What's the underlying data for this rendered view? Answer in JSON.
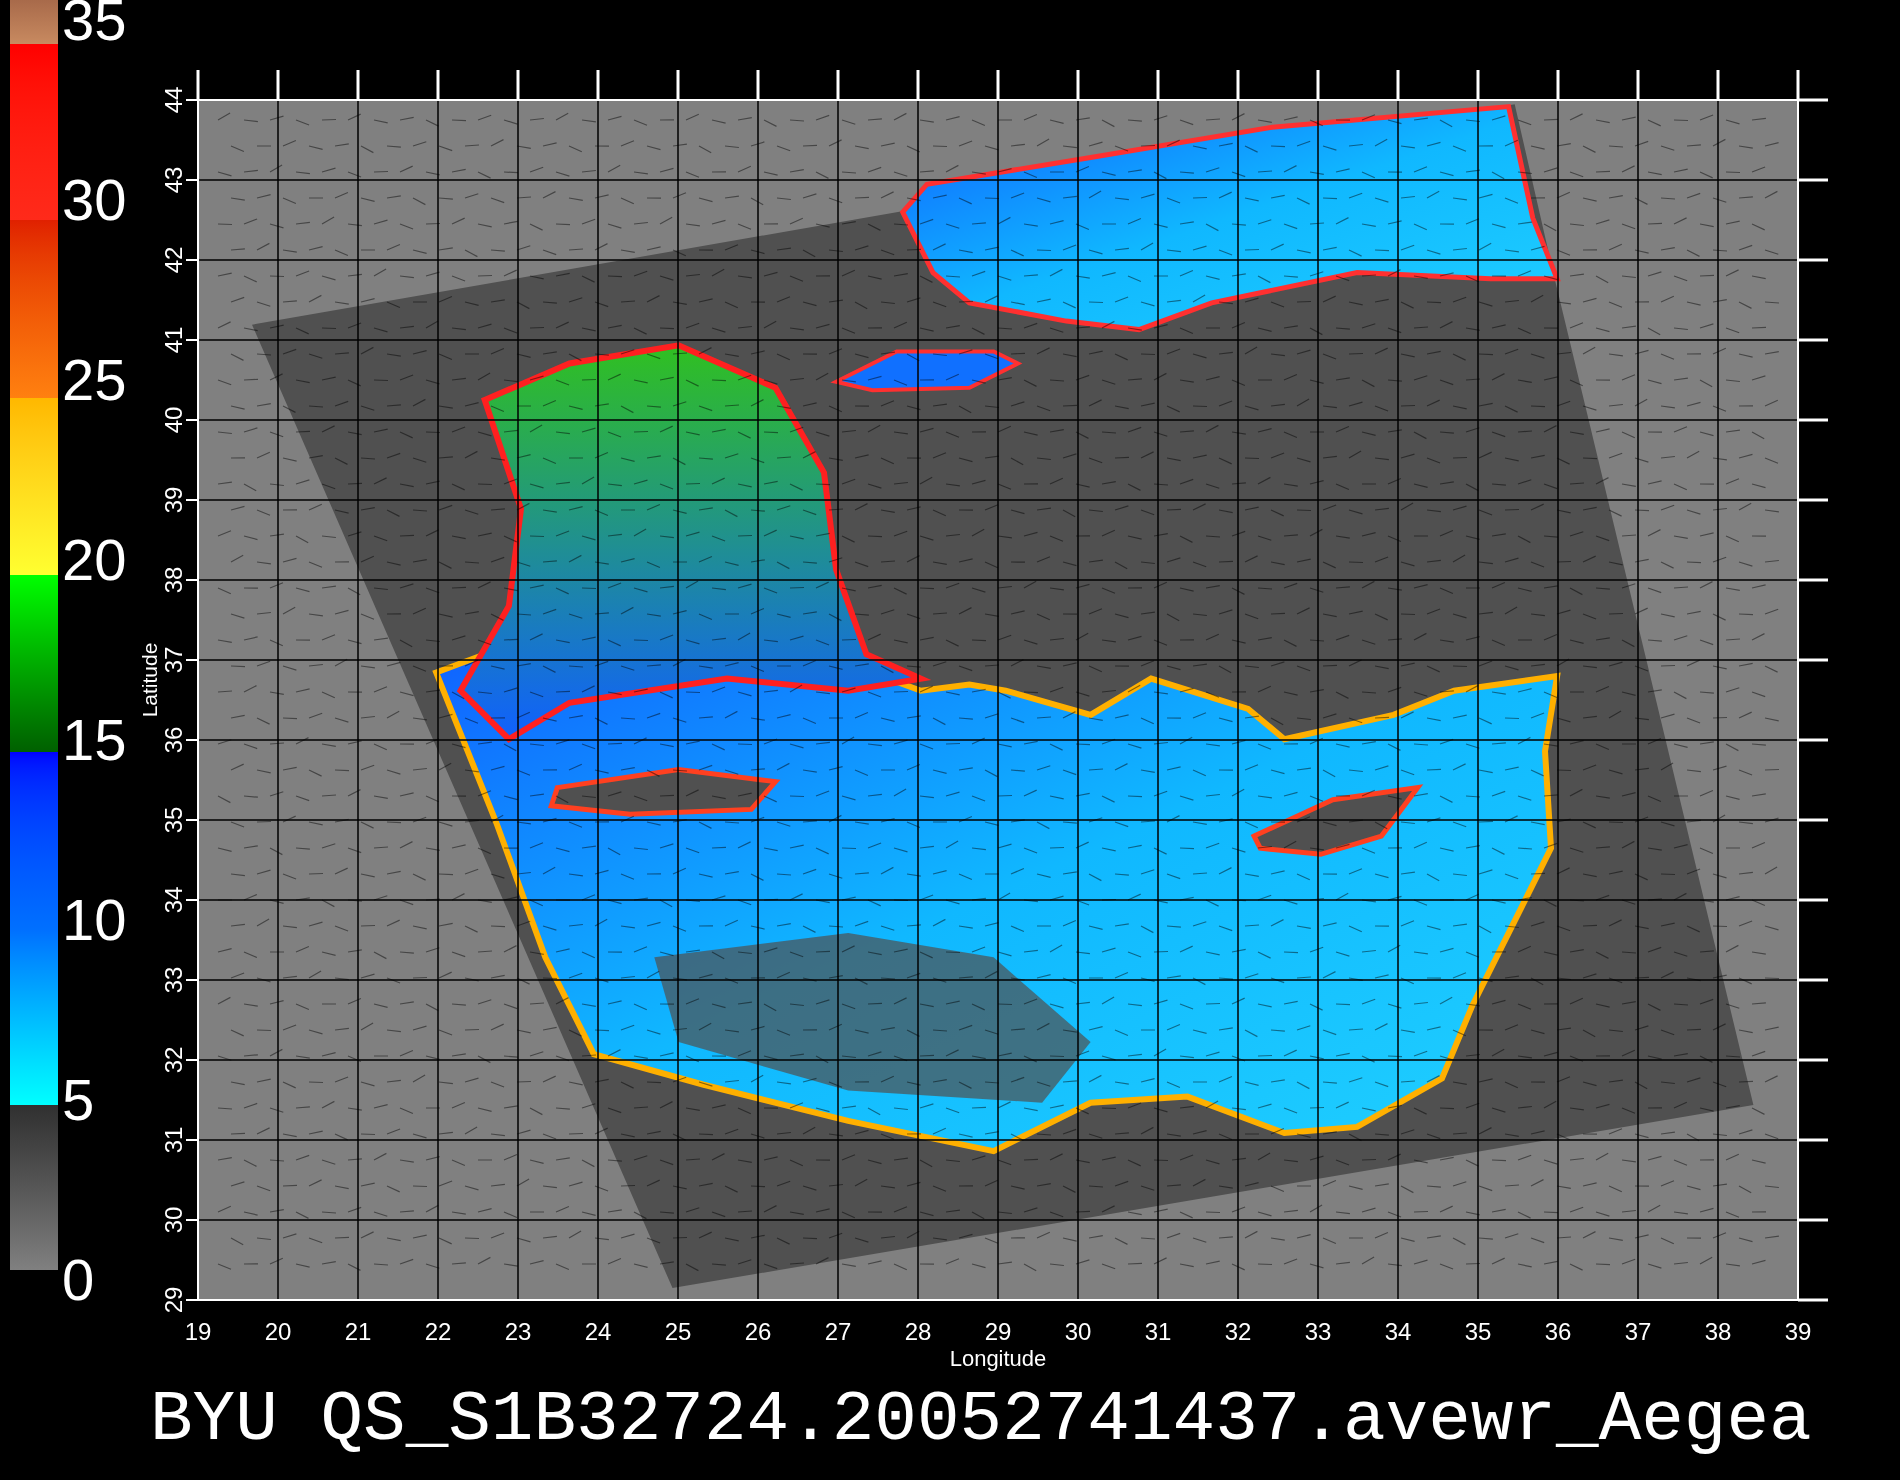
{
  "colorbar": {
    "labels": [
      "35",
      "30",
      "25",
      "20",
      "15",
      "10",
      "5",
      "0"
    ]
  },
  "map": {
    "latitude_labels": [
      "44",
      "43",
      "42",
      "41",
      "40",
      "39",
      "38",
      "37",
      "36",
      "35",
      "34",
      "33",
      "32",
      "31",
      "30",
      "29"
    ],
    "longitude_labels": [
      "19",
      "20",
      "21",
      "22",
      "23",
      "24",
      "25",
      "26",
      "27",
      "28",
      "29",
      "30",
      "31",
      "32",
      "33",
      "34",
      "35",
      "36",
      "37",
      "38",
      "39"
    ],
    "xlabel": "Longitude",
    "ylabel": "Latitude"
  },
  "title": "BYU QS_S1B32724.20052741437.avewr_Aegea"
}
